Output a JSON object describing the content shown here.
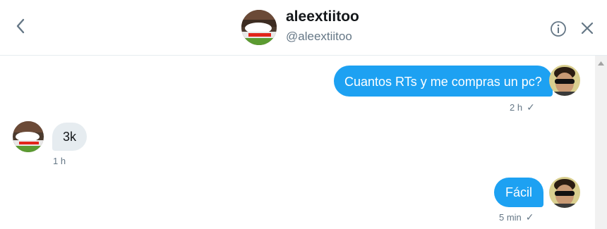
{
  "header": {
    "name": "aleextiitoo",
    "handle": "@aleextiitoo",
    "back_icon": "chevron-left-icon",
    "info_icon": "info-icon",
    "close_icon": "close-icon"
  },
  "messages": [
    {
      "direction": "sent",
      "text": "Cuantos RTs y me compras un pc?",
      "time": "2 h",
      "seen": "✓"
    },
    {
      "direction": "received",
      "text": "3k",
      "time": "1 h"
    },
    {
      "direction": "sent",
      "text": "Fácil",
      "time": "5 min",
      "seen": "✓"
    }
  ],
  "colors": {
    "accent": "#1da1f2",
    "received_bubble": "#e6ecf0",
    "muted_text": "#657786"
  }
}
